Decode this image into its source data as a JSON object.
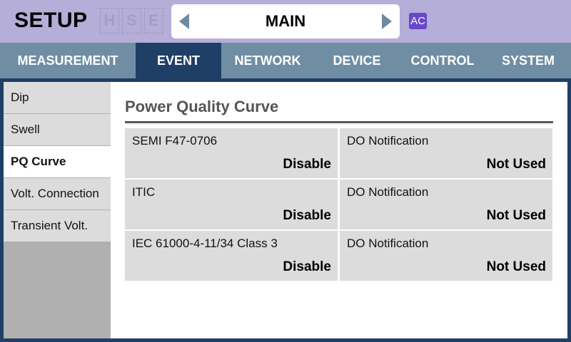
{
  "header": {
    "title": "SETUP",
    "hse": [
      "H",
      "S",
      "E"
    ],
    "selector_label": "MAIN",
    "ac_badge": "AC"
  },
  "nav": {
    "tabs": [
      "MEASUREMENT",
      "EVENT",
      "NETWORK",
      "DEVICE",
      "CONTROL",
      "SYSTEM"
    ],
    "active": "EVENT"
  },
  "sidebar": {
    "items": [
      "Dip",
      "Swell",
      "PQ Curve",
      "Volt. Connection",
      "Transient Volt."
    ],
    "active": "PQ Curve"
  },
  "main": {
    "section_title": "Power Quality Curve",
    "rows": [
      {
        "curve_name": "SEMI F47-0706",
        "curve_value": "Disable",
        "do_name": "DO Notification",
        "do_value": "Not Used"
      },
      {
        "curve_name": "ITIC",
        "curve_value": "Disable",
        "do_name": "DO Notification",
        "do_value": "Not Used"
      },
      {
        "curve_name": "IEC 61000-4-11/34 Class 3",
        "curve_value": "Disable",
        "do_name": "DO Notification",
        "do_value": "Not Used"
      }
    ]
  },
  "colors": {
    "header_bg": "#b4aed8",
    "nav_bg": "#708ea3",
    "accent_navy": "#1f3f66",
    "ac_badge": "#6a47c9"
  }
}
